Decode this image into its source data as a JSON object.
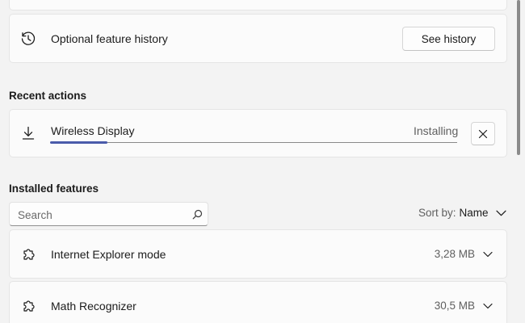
{
  "history_card": {
    "label": "Optional feature history",
    "button_label": "See history",
    "icon": "history-icon"
  },
  "recent_actions": {
    "title": "Recent actions",
    "item": {
      "label": "Wireless Display",
      "status": "Installing",
      "progress": 0.14,
      "icon": "download-icon",
      "cancel_icon": "close-icon"
    }
  },
  "installed_features": {
    "title": "Installed features",
    "search": {
      "placeholder": "Search",
      "value": ""
    },
    "sort": {
      "label": "Sort by:",
      "value": "Name"
    },
    "items": [
      {
        "label": "Internet Explorer mode",
        "size": "3,28 MB",
        "icon": "puzzle-icon"
      },
      {
        "label": "Math Recognizer",
        "size": "30,5 MB",
        "icon": "puzzle-icon"
      }
    ]
  },
  "colors": {
    "accent": "#4a5baa",
    "background": "#f3f3f3",
    "card": "#fbfbfb"
  }
}
